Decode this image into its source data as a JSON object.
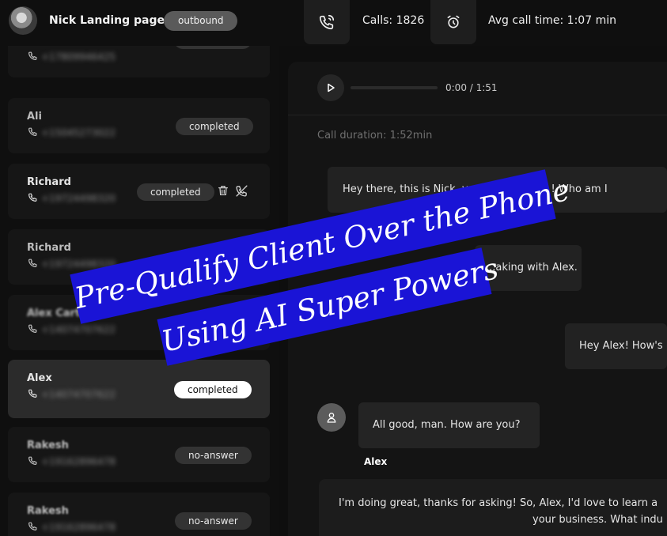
{
  "header": {
    "agent_name": "Nick Landing page",
    "direction": "outbound",
    "calls_label": "Calls: 1826",
    "avg_call_time_label": "Avg call time: 1:07 min"
  },
  "call_list": [
    {
      "name": "",
      "number": "+17809946425",
      "status": "completed"
    },
    {
      "name": "Ali",
      "number": "+15045273022",
      "status": "completed"
    },
    {
      "name": "Richard",
      "number": "+19724498320",
      "status": "completed"
    },
    {
      "name": "Richard",
      "number": "+19724498320",
      "status": ""
    },
    {
      "name": "Alex Carter",
      "number": "+14074707622",
      "status": ""
    },
    {
      "name": "Alex",
      "number": "+14074707622",
      "status": "completed"
    },
    {
      "name": "Rakesh",
      "number": "+19162896478",
      "status": "no-answer"
    },
    {
      "name": "Rakesh",
      "number": "+19162896478",
      "status": "no-answer"
    }
  ],
  "player": {
    "time": "0:00 / 1:51",
    "progress": 0
  },
  "transcript": {
    "duration": "Call duration: 1:52min",
    "messages": [
      {
        "speaker": "agent",
        "text": "Hey there, this is Nick, your AI assistant ! Who am I"
      },
      {
        "speaker": "agent",
        "text": "...aking with Alex."
      },
      {
        "speaker": "agent",
        "text": "Hey Alex! How's"
      },
      {
        "speaker": "user",
        "text": "All good, man. How are you?",
        "name": "Alex"
      },
      {
        "speaker": "agent",
        "lines": [
          "I'm doing great, thanks for asking! So, Alex, I'd love to learn a",
          "your business. What indu"
        ]
      }
    ]
  },
  "banner": {
    "line1": "Pre-Qualify Client Over the Phone",
    "line2": "Using AI Super Powers",
    "color": "#1a14d6"
  }
}
